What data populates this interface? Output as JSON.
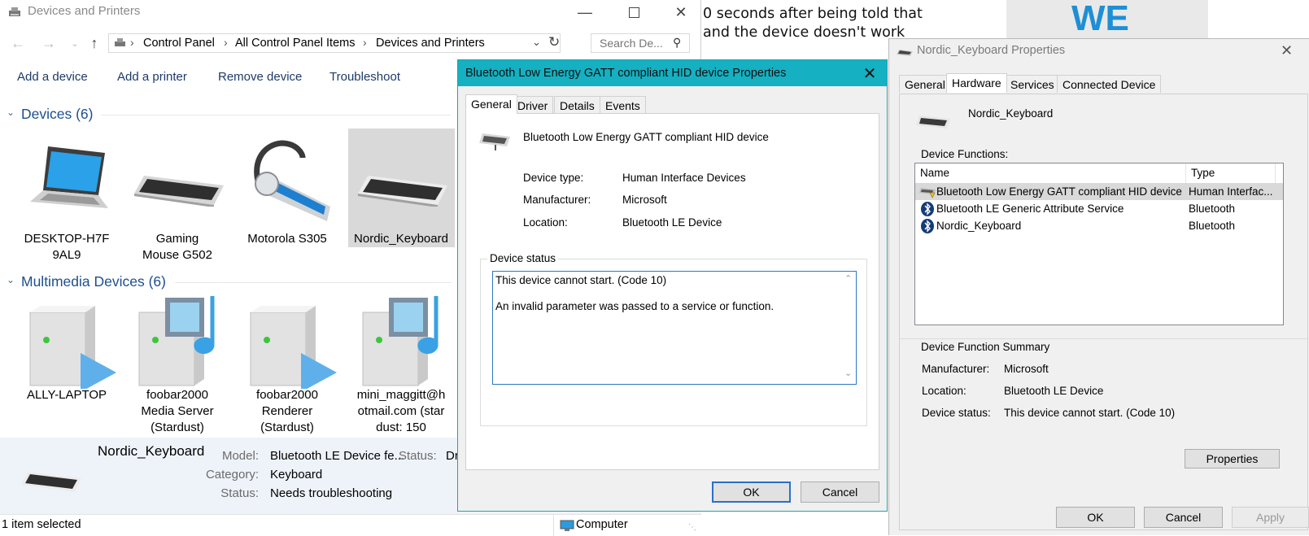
{
  "background": {
    "text_lines": [
      "0 seconds after being told that",
      "and the device doesn't work"
    ],
    "banner_text": "WE"
  },
  "explorer": {
    "title": "Devices and Printers",
    "breadcrumb": [
      "Control Panel",
      "All Control Panel Items",
      "Devices and Printers"
    ],
    "search_placeholder": "Search De...",
    "commands": [
      "Add a device",
      "Add a printer",
      "Remove device",
      "Troubleshoot"
    ],
    "groups": {
      "devices": {
        "heading": "Devices (6)",
        "items": [
          {
            "label": "DESKTOP-H7F9AL9",
            "icon": "laptop-icon"
          },
          {
            "label": "Gaming Mouse G502",
            "icon": "keyboard-icon"
          },
          {
            "label": "Motorola S305",
            "icon": "headset-icon"
          },
          {
            "label": "Nordic_Keyboard",
            "icon": "keyboard-icon",
            "selected": true
          }
        ]
      },
      "multimedia": {
        "heading": "Multimedia Devices (6)",
        "items": [
          {
            "label": "ALLY-LAPTOP",
            "icon": "media-server-icon"
          },
          {
            "label": "foobar2000 Media Server (Stardust)",
            "icon": "media-server-icon"
          },
          {
            "label": "foobar2000 Renderer (Stardust)",
            "icon": "media-renderer-icon"
          },
          {
            "label": "mini_maggitt@hotmail.com (stardust: 150",
            "icon": "media-server-icon"
          }
        ]
      }
    },
    "details": {
      "name": "Nordic_Keyboard",
      "model_label": "Model:",
      "model_value": "Bluetooth LE Device fe...",
      "status2_label": "Status:",
      "status2_value": "Dr",
      "category_label": "Category:",
      "category_value": "Keyboard",
      "status_label": "Status:",
      "status_value": "Needs troubleshooting"
    },
    "statusbar": {
      "selection": "1 item selected",
      "zone": "Computer"
    }
  },
  "gatt_dialog": {
    "title": "Bluetooth Low Energy GATT compliant HID device Properties",
    "tabs": [
      "General",
      "Driver",
      "Details",
      "Events"
    ],
    "active_tab": "General",
    "device_name": "Bluetooth Low Energy GATT compliant HID device",
    "device_type_label": "Device type:",
    "device_type_value": "Human Interface Devices",
    "manufacturer_label": "Manufacturer:",
    "manufacturer_value": "Microsoft",
    "location_label": "Location:",
    "location_value": "Bluetooth LE Device",
    "status_legend": "Device status",
    "status_line1": "This device cannot start. (Code 10)",
    "status_line2": "An invalid parameter was passed to a service or function.",
    "ok_label": "OK",
    "cancel_label": "Cancel"
  },
  "nordic_dialog": {
    "title": "Nordic_Keyboard Properties",
    "tabs": [
      "General",
      "Hardware",
      "Services",
      "Connected Device"
    ],
    "active_tab": "Hardware",
    "device_name": "Nordic_Keyboard",
    "functions_label": "Device Functions:",
    "columns": [
      "Name",
      "Type"
    ],
    "functions": [
      {
        "name": "Bluetooth Low Energy GATT compliant HID device",
        "type": "Human Interfac...",
        "icon": "hid-warning-icon",
        "selected": true
      },
      {
        "name": "Bluetooth LE Generic Attribute Service",
        "type": "Bluetooth",
        "icon": "bluetooth-icon"
      },
      {
        "name": "Nordic_Keyboard",
        "type": "Bluetooth",
        "icon": "bluetooth-icon"
      }
    ],
    "summary_legend": "Device Function Summary",
    "summary": {
      "manufacturer_label": "Manufacturer:",
      "manufacturer_value": "Microsoft",
      "location_label": "Location:",
      "location_value": "Bluetooth LE Device",
      "status_label": "Device status:",
      "status_value": "This device cannot start. (Code 10)"
    },
    "properties_label": "Properties",
    "ok_label": "OK",
    "cancel_label": "Cancel",
    "apply_label": "Apply"
  },
  "colors": {
    "gatt_titlebar": "#15b0c1",
    "link_blue": "#1e4f8f",
    "selection_gray": "#d9d9d9"
  }
}
